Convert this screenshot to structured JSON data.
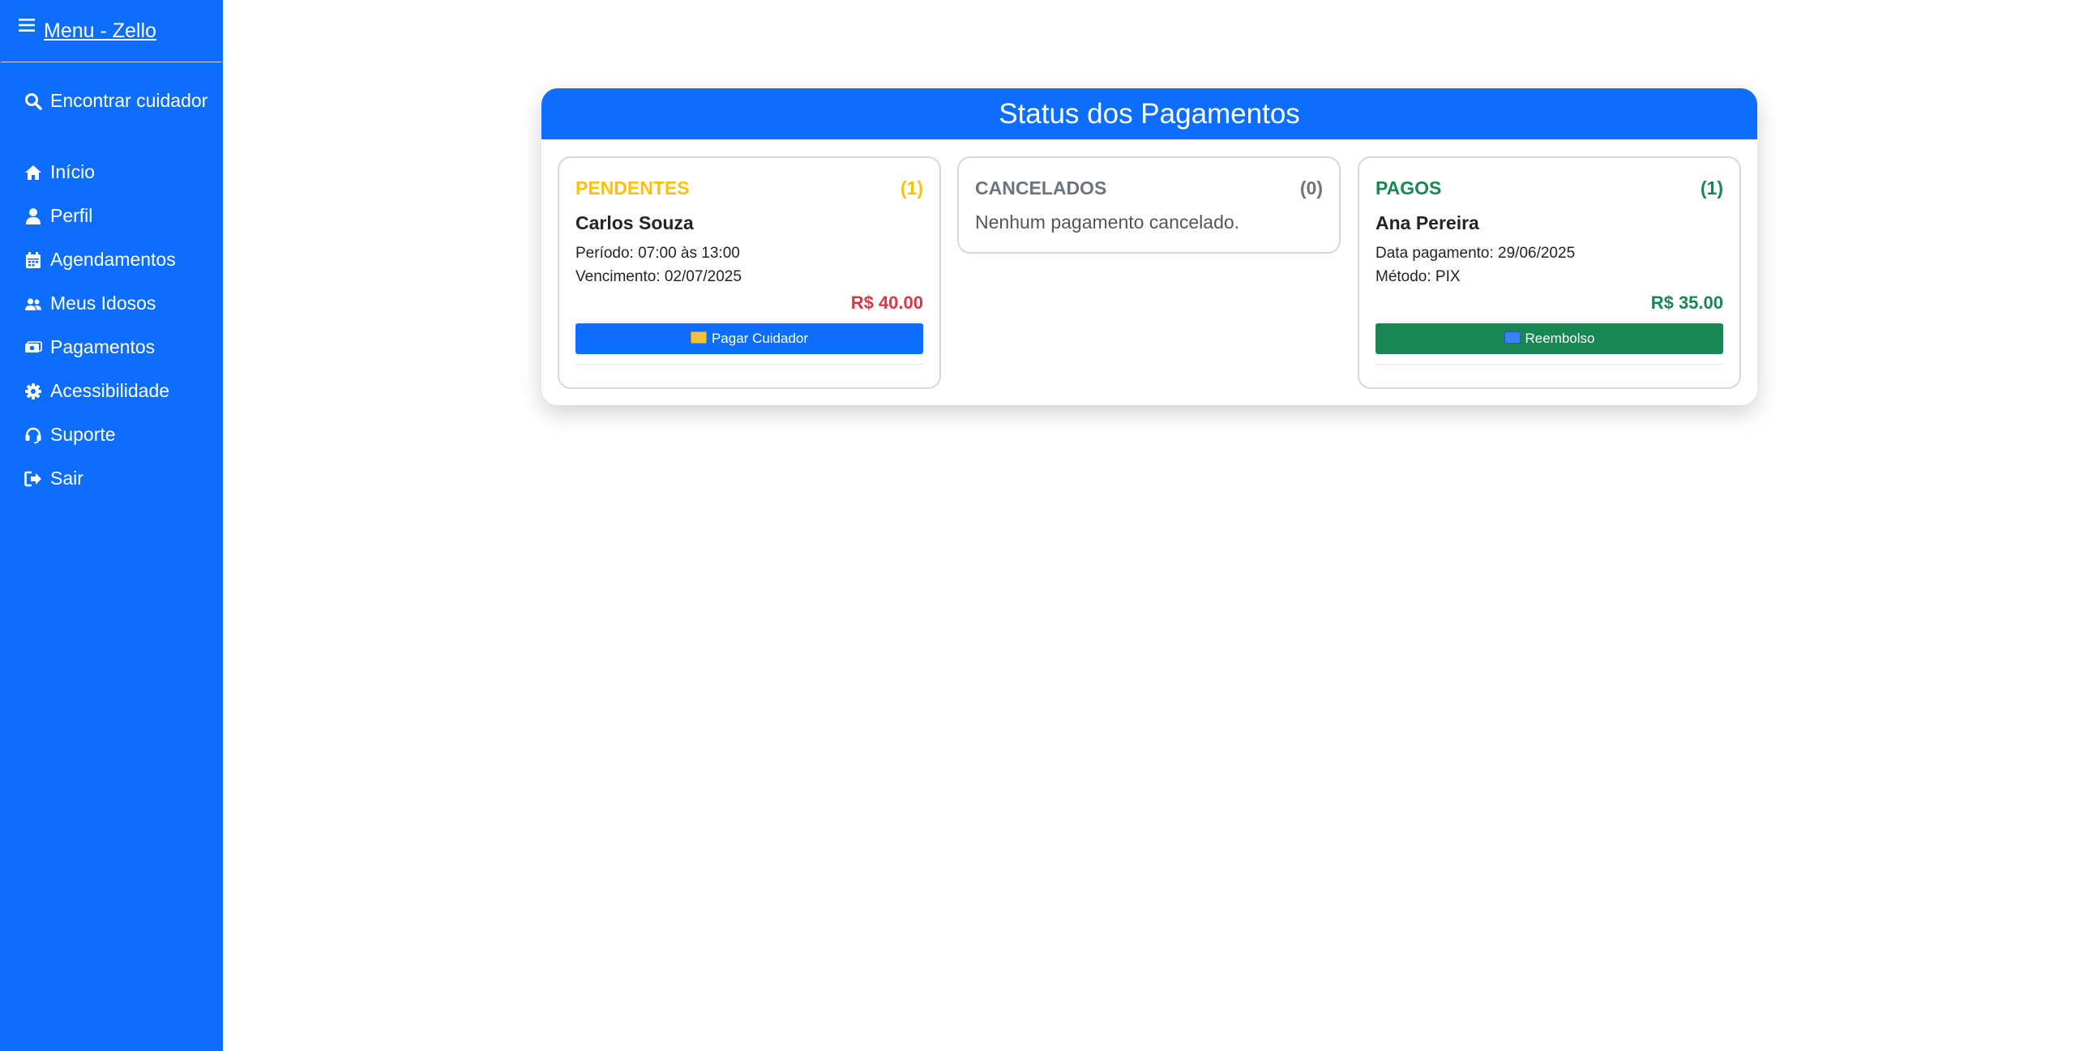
{
  "sidebar": {
    "title": "Menu - Zello",
    "items": [
      {
        "label": "Encontrar cuidador",
        "icon": "search-icon"
      },
      {
        "label": "Início",
        "icon": "home-icon"
      },
      {
        "label": "Perfil",
        "icon": "user-icon"
      },
      {
        "label": "Agendamentos",
        "icon": "calendar-icon"
      },
      {
        "label": "Meus Idosos",
        "icon": "users-icon"
      },
      {
        "label": "Pagamentos",
        "icon": "money-icon"
      },
      {
        "label": "Acessibilidade",
        "icon": "gear-icon"
      },
      {
        "label": "Suporte",
        "icon": "headset-icon"
      },
      {
        "label": "Sair",
        "icon": "logout-icon"
      }
    ]
  },
  "panel": {
    "title": "Status dos Pagamentos",
    "pendentes": {
      "label": "PENDENTES",
      "count": "(1)",
      "name": "Carlos Souza",
      "line1": "Período: 07:00 às 13:00",
      "line2": "Vencimento: 02/07/2025",
      "amount": "R$ 40.00",
      "button": "Pagar Cuidador",
      "button_icon": "credit-card-emoji-icon"
    },
    "cancelados": {
      "label": "CANCELADOS",
      "count": "(0)",
      "empty": "Nenhum pagamento cancelado."
    },
    "pagos": {
      "label": "PAGOS",
      "count": "(1)",
      "name": "Ana Pereira",
      "line1": "Data pagamento: 29/06/2025",
      "line2": "Método: PIX",
      "amount": "R$ 35.00",
      "button": "Reembolso",
      "button_icon": "repeat-emoji-icon"
    }
  },
  "colors": {
    "primary": "#0d6efd",
    "pending": "#ffc107",
    "cancelled": "#6c757d",
    "paid": "#198754",
    "amount_due": "#dc3545"
  }
}
